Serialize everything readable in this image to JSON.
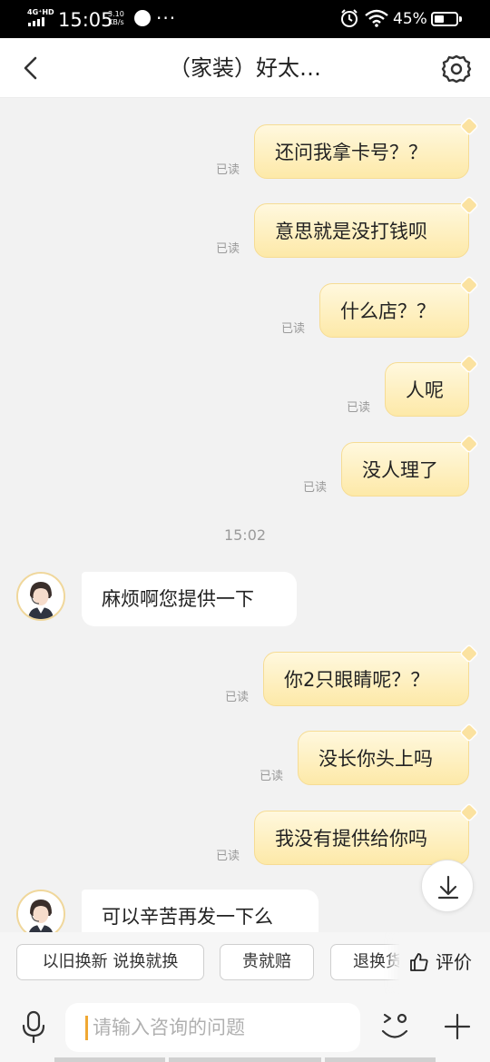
{
  "status_bar": {
    "network": "4G⁺HD",
    "time": "15:05",
    "speed_value": "3.10",
    "speed_unit": "KB/s",
    "more": "···",
    "battery": "45%",
    "battery_level": 0.45
  },
  "header": {
    "title": "（家装）好太…",
    "back_icon": "chevron-left-icon",
    "settings_icon": "gear-icon"
  },
  "messages": [
    {
      "direction": "out",
      "text": "还问我拿卡号？？",
      "read": "已读"
    },
    {
      "direction": "out",
      "text": "意思就是没打钱呗",
      "read": "已读"
    },
    {
      "direction": "out",
      "text": "什么店？？",
      "read": "已读"
    },
    {
      "direction": "out",
      "text": "人呢",
      "read": "已读"
    },
    {
      "direction": "out",
      "text": "没人理了",
      "read": "已读"
    },
    {
      "direction": "timestamp",
      "text": "15:02"
    },
    {
      "direction": "in",
      "text": "麻烦啊您提供一下"
    },
    {
      "direction": "out",
      "text": "你2只眼睛呢？？",
      "read": "已读"
    },
    {
      "direction": "out",
      "text": "没长你头上吗",
      "read": "已读"
    },
    {
      "direction": "out",
      "text": "我没有提供给你吗",
      "read": "已读"
    },
    {
      "direction": "in",
      "text": "可以辛苦再发一下么"
    }
  ],
  "quick_replies": [
    "以旧换新 说换就换",
    "贵就赔",
    "退换货"
  ],
  "rate_label": "评价",
  "input": {
    "placeholder": "请输入咨询的问题"
  },
  "colors": {
    "accent": "#f0a833",
    "bubble_out_top": "#fff8de",
    "bubble_out_bottom": "#fde9a8",
    "background": "#f2f2f2"
  },
  "icons": {
    "scroll_down": "arrow-down-icon",
    "mic": "mic-icon",
    "emoji": "emoji-icon",
    "plus": "plus-icon",
    "rate": "thumbs-up-icon",
    "bubble_tag": "diamond-tag-icon"
  }
}
